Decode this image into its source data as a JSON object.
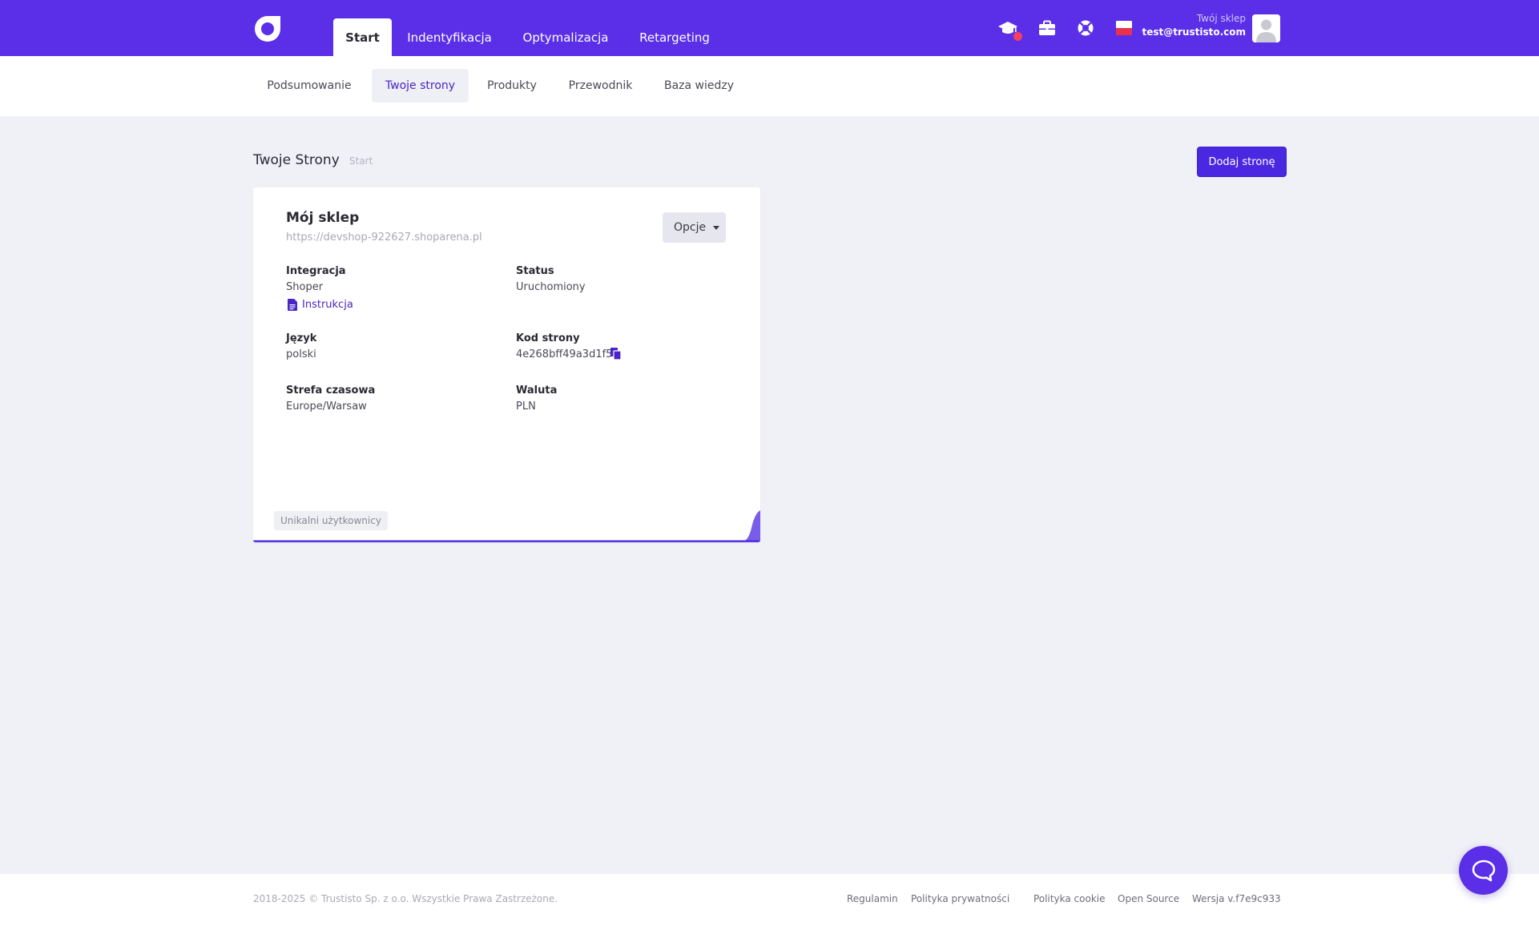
{
  "colors": {
    "brand": "#5b2ee8",
    "accent_text": "#4a24c6",
    "page_bg": "#f0f1f6",
    "notification": "#f24060"
  },
  "topbar": {
    "logo_icon": "brand-logo-icon",
    "tabs": [
      {
        "label": "Start",
        "active": true
      },
      {
        "label": "Indentyfikacja",
        "active": false
      },
      {
        "label": "Optymalizacja",
        "active": false
      },
      {
        "label": "Retargeting",
        "active": false
      }
    ],
    "icons": [
      "graduation-cap-icon",
      "briefcase-icon",
      "lifebuoy-icon",
      "flag-pl-icon"
    ],
    "shop_label": "Twój sklep",
    "user_email": "test@trustisto.com"
  },
  "subnav": {
    "tabs": [
      {
        "label": "Podsumowanie",
        "active": false
      },
      {
        "label": "Twoje strony",
        "active": true
      },
      {
        "label": "Produkty",
        "active": false
      },
      {
        "label": "Przewodnik",
        "active": false
      },
      {
        "label": "Baza wiedzy",
        "active": false
      }
    ]
  },
  "page": {
    "title": "Twoje Strony",
    "breadcrumb": "Start",
    "add_button": "Dodaj stronę"
  },
  "site_card": {
    "name": "Mój sklep",
    "url": "https://devshop-922627.shoparena.pl",
    "options_label": "Opcje",
    "integration_label": "Integracja",
    "integration_value": "Shoper",
    "instructions_link": "Instrukcja",
    "status_label": "Status",
    "status_value": "Uruchomiony",
    "language_label": "Język",
    "language_value": "polski",
    "code_label": "Kod strony",
    "code_value": "4e268bff49a3d1f5",
    "timezone_label": "Strefa czasowa",
    "timezone_value": "Europe/Warsaw",
    "currency_label": "Waluta",
    "currency_value": "PLN",
    "chart_label": "Unikalni użytkownicy"
  },
  "footer": {
    "copyright": "2018-2025 © Trustisto Sp. z o.o. Wszystkie Prawa Zastrzeżone.",
    "links": [
      "Regulamin",
      "Polityka prywatności",
      "Polityka cookie",
      "Open Source",
      "Wersja v.f7e9c933"
    ]
  }
}
